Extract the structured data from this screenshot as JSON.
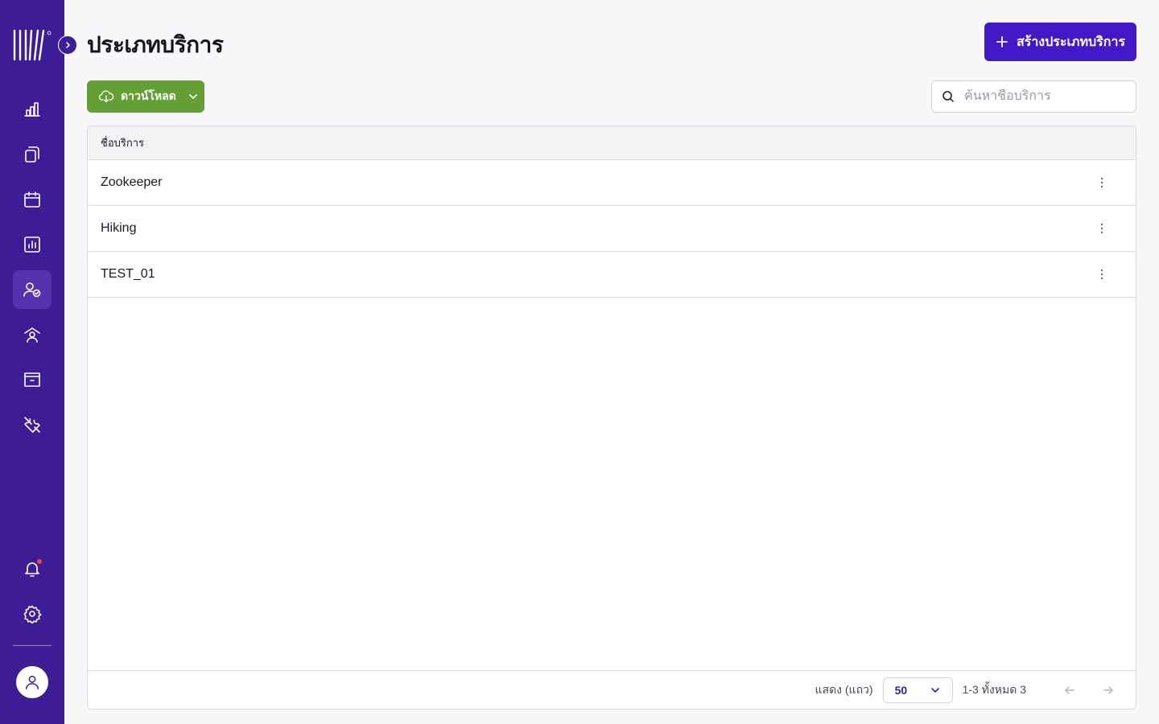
{
  "page": {
    "title": "ประเภทบริการ"
  },
  "toolbar": {
    "create_label": "สร้างประเภทบริการ",
    "download_label": "ดาวน์โหลด"
  },
  "search": {
    "placeholder": "ค้นหาชื่อบริการ",
    "value": ""
  },
  "table": {
    "column_header": "ชื่อบริการ",
    "rows": [
      {
        "name": "Zookeeper"
      },
      {
        "name": "Hiking"
      },
      {
        "name": "TEST_01"
      }
    ]
  },
  "pagination": {
    "rows_label": "แสดง (แถว)",
    "page_size": "50",
    "range_text": "1-3 ทั้งหมด 3"
  },
  "sidebar": {
    "items": [
      {
        "icon": "bar-chart-icon"
      },
      {
        "icon": "copy-documents-icon"
      },
      {
        "icon": "calendar-icon"
      },
      {
        "icon": "report-chart-icon"
      },
      {
        "icon": "user-check-icon",
        "active": true
      },
      {
        "icon": "user-home-icon"
      },
      {
        "icon": "archive-box-icon"
      },
      {
        "icon": "tools-icon"
      }
    ],
    "bottom": [
      {
        "icon": "bell-icon",
        "has_notification": true
      },
      {
        "icon": "gear-icon"
      }
    ]
  },
  "colors": {
    "sidebar_bg": "#3d1d96",
    "primary": "#4318c7",
    "download_green": "#649e34",
    "notification_red": "#ef4444"
  }
}
